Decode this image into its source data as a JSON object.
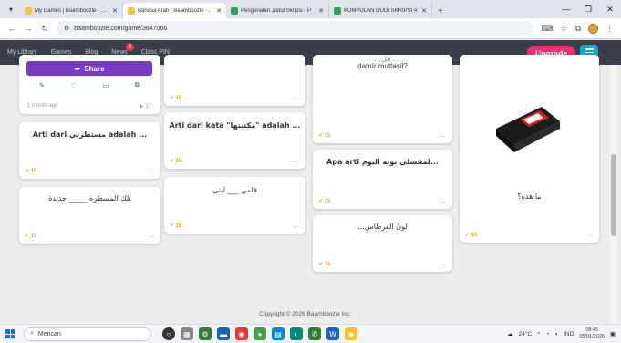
{
  "browser": {
    "tabs": [
      {
        "title": "My Games | Baamboozle - Baa",
        "color": "#f5c242",
        "active": false
      },
      {
        "title": "Bahasa Arab | Baamboozle - Ba",
        "color": "#f5c242",
        "active": true
      },
      {
        "title": "Pengenalan Judul Skripsi - P",
        "color": "#2aa35a",
        "active": false
      },
      {
        "title": "KUMPULAN IJUDI SKRIPSI A",
        "color": "#2aa35a",
        "active": false
      }
    ],
    "close_glyph": "✕",
    "url": "baamboozle.com/game/3847066",
    "new_tab": "+"
  },
  "site_nav": {
    "links": [
      "My Library",
      "Games",
      "Blog",
      "News",
      "Class PIN"
    ],
    "news_badge": "3",
    "upgrade_label": "Upgrade"
  },
  "profile_card": {
    "share_label": "Share",
    "age": "1 month ago",
    "plays": "▶ 37"
  },
  "points_label": "15",
  "cards": {
    "c1": "Arti dari مستطرتي adalah ...",
    "c2": "تلك المسطرة _____ جديدة",
    "c3": "Arti dari kata \"مكتبتها\" adalah ...",
    "c4": "قلمي ___ لبنى",
    "c5a": "...هل",
    "c5b": "ḍamīr muttaṣil?",
    "c6": "Apa arti لمقسلي تونة اليوم...",
    "c7": "...لونُ القرطاسِ",
    "c8": "ما هذه؟"
  },
  "footer": {
    "copyright": "Copyright © 2026 Baamboozle Inc."
  },
  "taskbar": {
    "search_placeholder": "Mencari",
    "weather": "24°C",
    "lang": "IND",
    "time": "08:45",
    "date": "05/01/2026"
  },
  "colors": {
    "accent": "#7a3bc2",
    "upgrade": "#e8336f",
    "points": "#e5a51a"
  }
}
